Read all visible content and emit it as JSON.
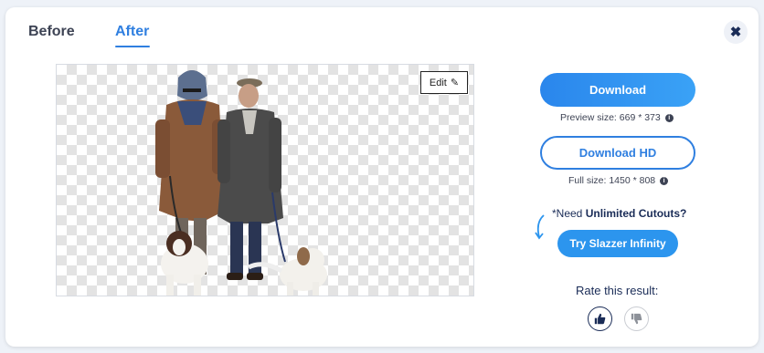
{
  "tabs": [
    {
      "label": "Before",
      "active": false
    },
    {
      "label": "After",
      "active": true
    }
  ],
  "close_icon": "close-icon",
  "edit": {
    "label": "Edit",
    "icon": "pencil-icon"
  },
  "download": {
    "label": "Download",
    "preview_size": "Preview size: 669 * 373"
  },
  "download_hd": {
    "label": "Download HD",
    "full_size": "Full size: 1450 * 808"
  },
  "promo": {
    "prefix": "*Need ",
    "highlight": "Unlimited Cutouts?",
    "button": "Try Slazzer Infinity"
  },
  "rating": {
    "label": "Rate this result:",
    "up_icon": "thumbs-up-icon",
    "down_icon": "thumbs-down-icon"
  },
  "colors": {
    "accent": "#2f7fe0",
    "navy": "#1a2c57",
    "background": "#eef2f8"
  }
}
